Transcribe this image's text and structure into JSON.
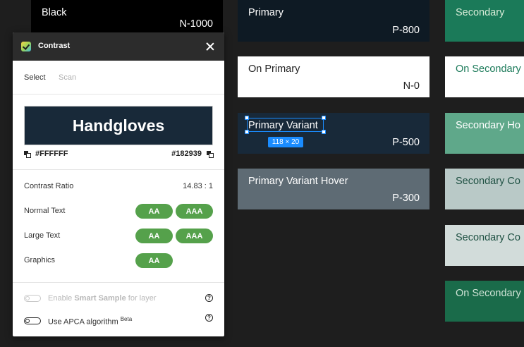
{
  "canvas": {
    "swatches": [
      {
        "name": "Black",
        "code": "N-1000",
        "bg": "#000000",
        "fg": "#ffffff"
      },
      {
        "name": "Primary",
        "code": "P-800",
        "bg": "#0e1a24",
        "fg": "#ffffff"
      },
      {
        "name": "On Primary",
        "code": "N-0",
        "bg": "#ffffff",
        "fg": "#222222"
      },
      {
        "name": "Primary Variant",
        "code": "P-500",
        "bg": "#182939",
        "fg": "#ffffff"
      },
      {
        "name": "Primary Variant Hover",
        "code": "P-300",
        "bg": "#5e6b74",
        "fg": "#ffffff"
      },
      {
        "name": "Secondary",
        "code": "",
        "bg": "#1b7a59",
        "fg": "#d8ecd8"
      },
      {
        "name": "On Secondary",
        "code": "",
        "bg": "#ffffff",
        "fg": "#1b7a59"
      },
      {
        "name": "Secondary Ho",
        "code": "",
        "bg": "#5fa88a",
        "fg": "#ffffff"
      },
      {
        "name": "Secondary Co",
        "code": "",
        "bg": "#b9c9c7",
        "fg": "#1f5143"
      },
      {
        "name": "Secondary Co",
        "code": "",
        "bg": "#d2dcda",
        "fg": "#1f5143"
      },
      {
        "name": "On Secondary",
        "code": "",
        "bg": "#1a6b4a",
        "fg": "#cfe3d6"
      }
    ],
    "selection": {
      "dimensions": "118 × 20"
    }
  },
  "panel": {
    "title": "Contrast",
    "tabs": [
      "Select",
      "Scan"
    ],
    "preview": {
      "text": "Handgloves",
      "foreground": "#FFFFFF",
      "background": "#182939"
    },
    "contrast_ratio": {
      "label": "Contrast Ratio",
      "value": "14.83 : 1"
    },
    "rows": [
      {
        "label": "Normal Text",
        "badges": [
          "AA",
          "AAA"
        ]
      },
      {
        "label": "Large Text",
        "badges": [
          "AA",
          "AAA"
        ]
      },
      {
        "label": "Graphics",
        "badges": [
          "AA"
        ]
      }
    ],
    "smart_sample": {
      "prefix": "Enable",
      "bold": "Smart Sample",
      "suffix": "for layer"
    },
    "apca": {
      "label": "Use APCA algorithm",
      "sup": "Beta"
    },
    "help_glyph": "?"
  },
  "colors": {
    "badge": "#55a14b",
    "selection": "#1a8cff",
    "canvas": "#1e1e1e"
  }
}
